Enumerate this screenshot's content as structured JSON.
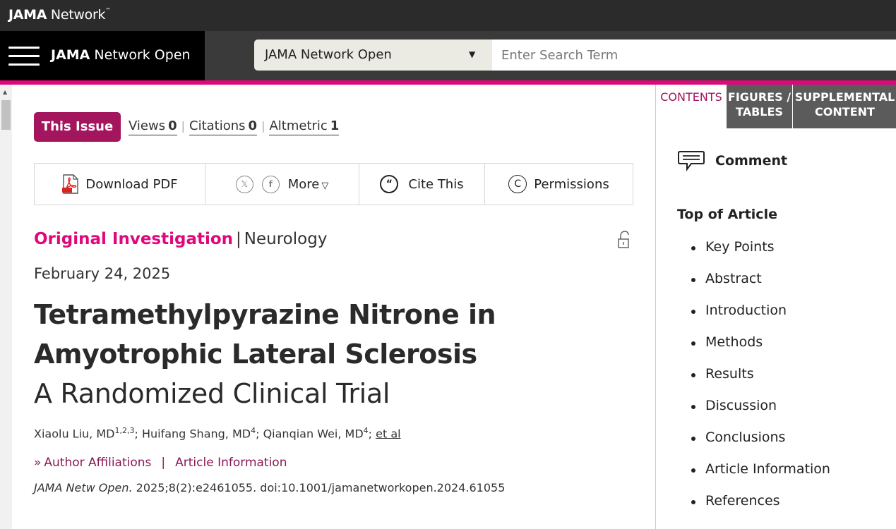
{
  "topbar": {
    "brand_bold": "JAMA",
    "brand_rest": " Network",
    "brand_tm": "™"
  },
  "nav": {
    "journal_bold": "JAMA",
    "journal_rest": " Network Open",
    "select_value": "JAMA Network Open",
    "search_placeholder": "Enter Search Term"
  },
  "article_tools": {
    "this_issue": "This Issue",
    "views_label": "Views",
    "views_count": "0",
    "citations_label": "Citations",
    "citations_count": "0",
    "altmetric_label": "Altmetric",
    "altmetric_count": "1"
  },
  "actions": {
    "download_pdf": "Download PDF",
    "more": "More",
    "cite_this": "Cite This",
    "permissions": "Permissions"
  },
  "article": {
    "type": "Original Investigation",
    "topic": "Neurology",
    "date": "February 24, 2025",
    "title_line1": "Tetramethylpyrazine Nitrone in",
    "title_line2": "Amyotrophic Lateral Sclerosis",
    "subtitle": "A Randomized Clinical Trial",
    "authors": [
      {
        "name": "Xiaolu Liu, MD",
        "sup": "1,2,3"
      },
      {
        "name": "Huifang Shang, MD",
        "sup": "4"
      },
      {
        "name": "Qianqian Wei, MD",
        "sup": "4"
      }
    ],
    "et_al": "et al",
    "author_affiliations": "Author Affiliations",
    "article_information": "Article Information",
    "citation_journal": "JAMA Netw Open.",
    "citation_rest": " 2025;8(2):e2461055. doi:10.1001/jamanetworkopen.2024.61055"
  },
  "sidebar": {
    "tabs": [
      "CONTENTS",
      "FIGURES / TABLES",
      "SUPPLEMENTAL CONTENT"
    ],
    "comment": "Comment",
    "toc_heading": "Top of Article",
    "toc": [
      "Key Points",
      "Abstract",
      "Introduction",
      "Methods",
      "Results",
      "Discussion",
      "Conclusions",
      "Article Information",
      "References"
    ]
  },
  "colors": {
    "accent_pink": "#e0077d",
    "issue_maroon": "#a3155c",
    "tab_gray": "#5b5b5b"
  }
}
